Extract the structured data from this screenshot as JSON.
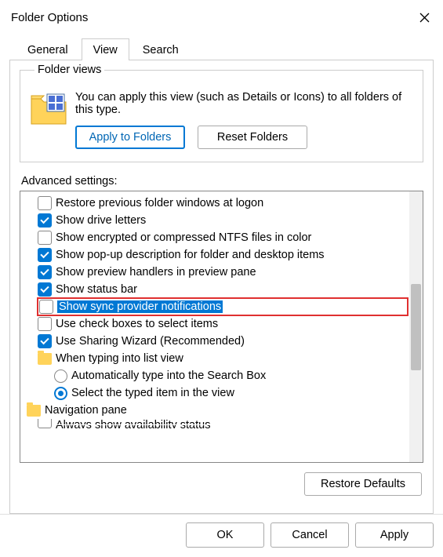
{
  "window": {
    "title": "Folder Options"
  },
  "tabs": {
    "general": "General",
    "view": "View",
    "search": "Search",
    "active": "view"
  },
  "folder_views": {
    "legend": "Folder views",
    "desc": "You can apply this view (such as Details or Icons) to all folders of this type.",
    "apply_btn": "Apply to Folders",
    "reset_btn": "Reset Folders"
  },
  "advanced": {
    "label": "Advanced settings:",
    "items": [
      {
        "type": "checkbox",
        "checked": false,
        "label": "Restore previous folder windows at logon"
      },
      {
        "type": "checkbox",
        "checked": true,
        "label": "Show drive letters"
      },
      {
        "type": "checkbox",
        "checked": false,
        "label": "Show encrypted or compressed NTFS files in color"
      },
      {
        "type": "checkbox",
        "checked": true,
        "label": "Show pop-up description for folder and desktop items"
      },
      {
        "type": "checkbox",
        "checked": true,
        "label": "Show preview handlers in preview pane"
      },
      {
        "type": "checkbox",
        "checked": true,
        "label": "Show status bar"
      },
      {
        "type": "checkbox",
        "checked": false,
        "label": "Show sync provider notifications",
        "highlighted": true
      },
      {
        "type": "checkbox",
        "checked": false,
        "label": "Use check boxes to select items"
      },
      {
        "type": "checkbox",
        "checked": true,
        "label": "Use Sharing Wizard (Recommended)"
      },
      {
        "type": "folder",
        "label": "When typing into list view"
      },
      {
        "type": "radio",
        "checked": false,
        "label": "Automatically type into the Search Box",
        "indent": 1
      },
      {
        "type": "radio",
        "checked": true,
        "label": "Select the typed item in the view",
        "indent": 1
      }
    ],
    "nav_pane": "Navigation pane",
    "cutoff": "Always show availability status"
  },
  "restore_defaults": "Restore Defaults",
  "footer": {
    "ok": "OK",
    "cancel": "Cancel",
    "apply": "Apply"
  }
}
